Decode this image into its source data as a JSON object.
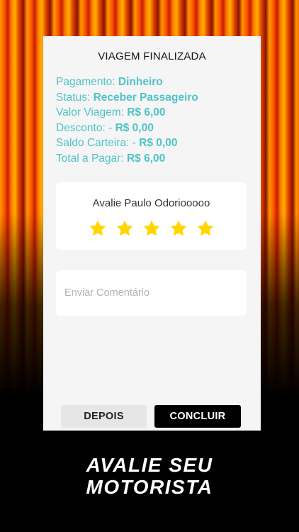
{
  "card": {
    "title": "VIAGEM FINALIZADA",
    "info": [
      {
        "label": "Pagamento: ",
        "value": "Dinheiro"
      },
      {
        "label": "Status: ",
        "value": "Receber Passageiro"
      },
      {
        "label": "Valor Viagem:  ",
        "value": "R$ 6,00"
      },
      {
        "label": "Desconto:  -  ",
        "value": "R$ 0,00"
      },
      {
        "label": "Saldo Carteira:  -  ",
        "value": "R$ 0,00"
      },
      {
        "label": "Total a Pagar:  ",
        "value": "R$ 6,00"
      }
    ],
    "rating": {
      "title": "Avalie Paulo Odoriooooo",
      "stars_filled": 5,
      "stars_total": 5,
      "star_color": "#ffd600"
    },
    "comment": {
      "placeholder": "Enviar Comentário",
      "value": ""
    },
    "buttons": {
      "later": "DEPOIS",
      "done": "CONCLUIR"
    }
  },
  "tagline": {
    "line1": "AVALIE SEU",
    "line2": "MOTORISTA"
  },
  "colors": {
    "accent": "#4fc3c7",
    "star": "#ffd600",
    "card_bg": "#f5f5f5"
  }
}
